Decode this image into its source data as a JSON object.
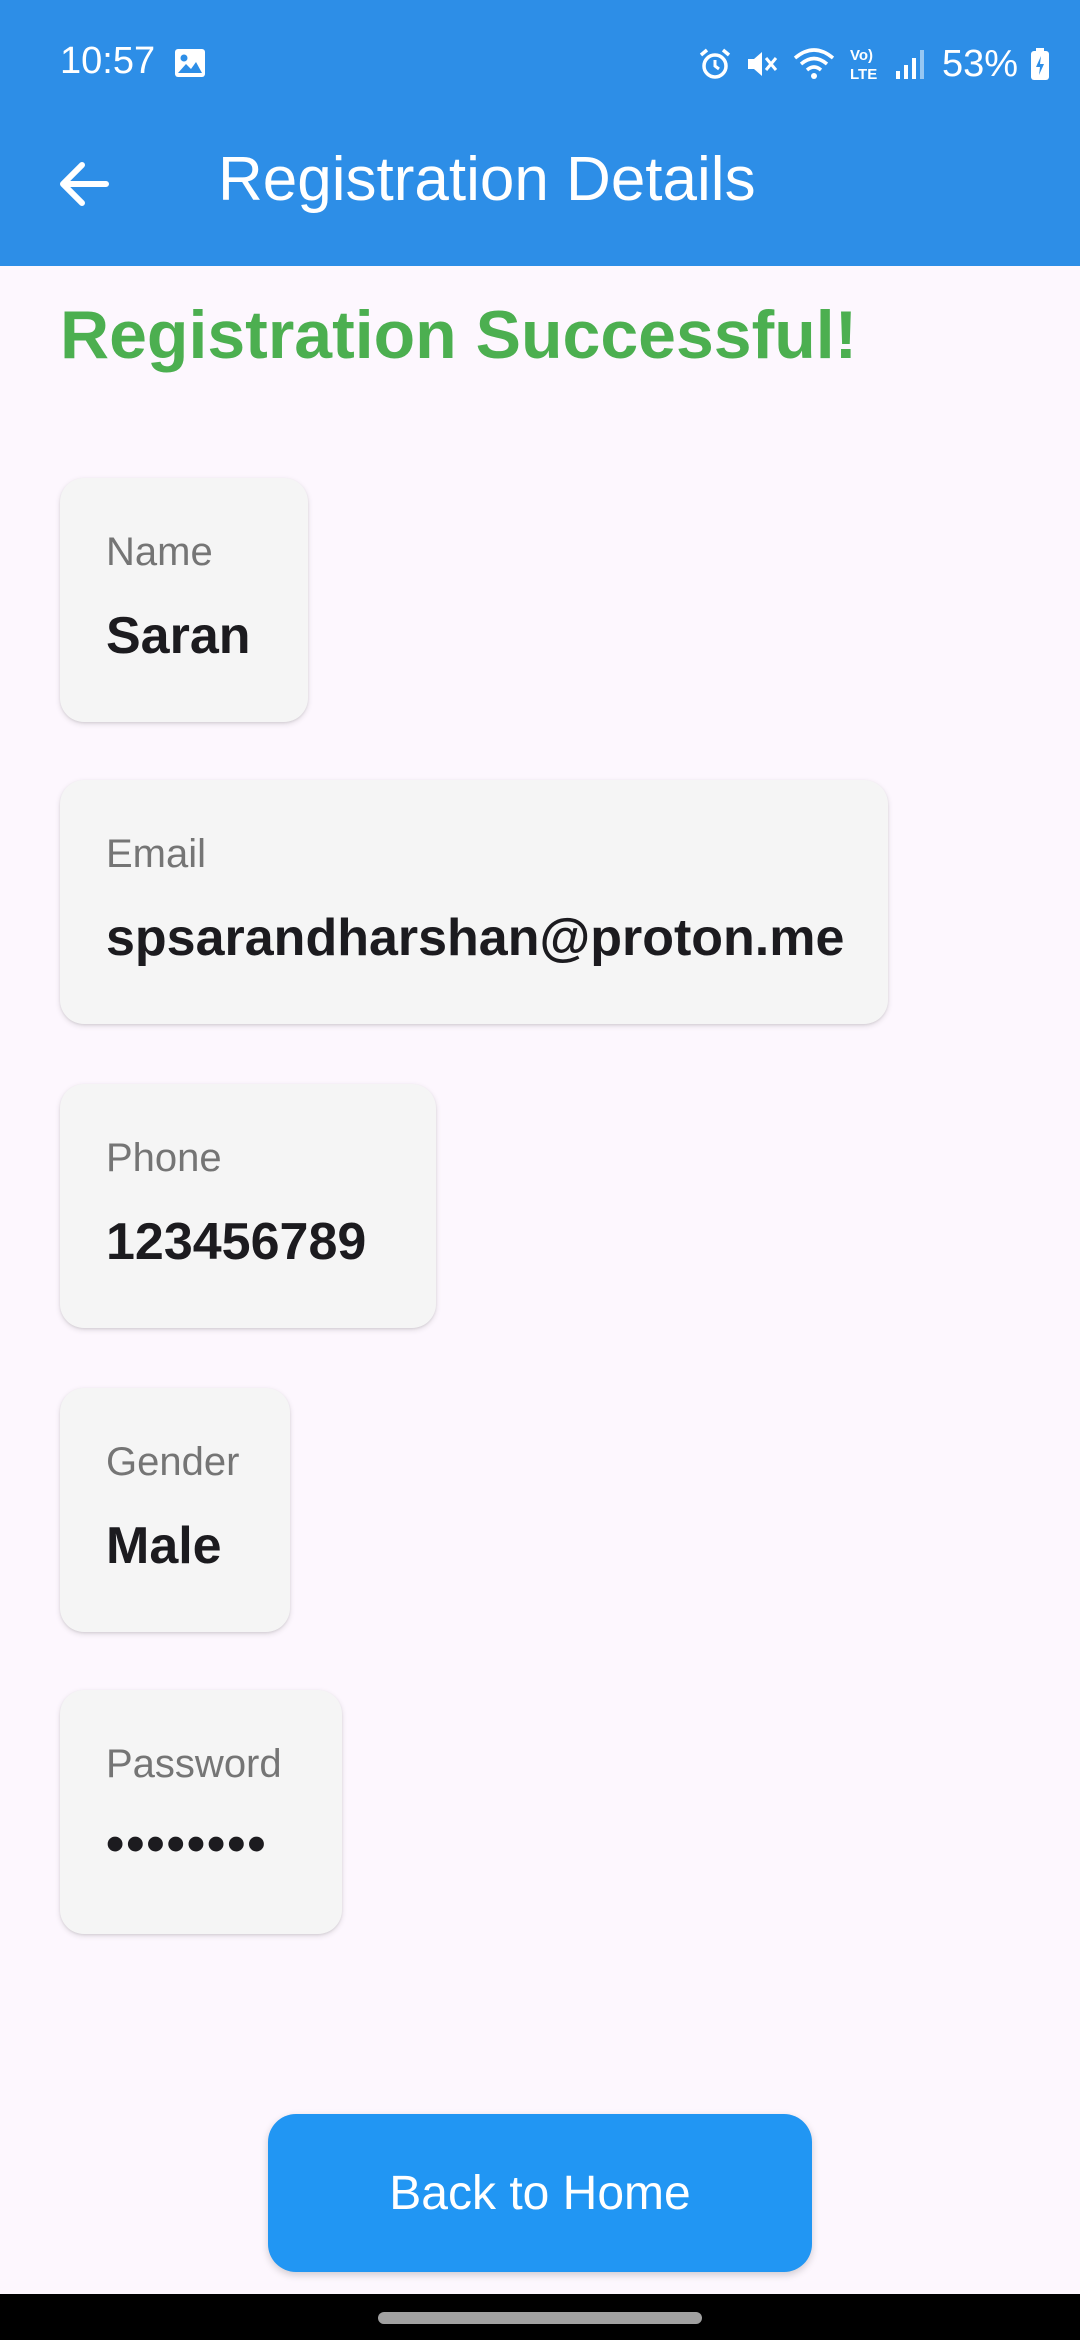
{
  "status_bar": {
    "time": "10:57",
    "battery_percent": "53%",
    "icons": [
      "gallery-icon",
      "alarm-icon",
      "mute-icon",
      "wifi-icon",
      "volte-icon",
      "signal-icon",
      "battery-icon"
    ]
  },
  "appbar": {
    "title": "Registration Details",
    "back_icon": "arrow-left-icon",
    "color": "#2d8ee7"
  },
  "heading": {
    "text": "Registration Successful!",
    "color": "#4caf50"
  },
  "fields": [
    {
      "label": "Name",
      "value": "Saran"
    },
    {
      "label": "Email",
      "value": "spsarandharshan@proton.me"
    },
    {
      "label": "Phone",
      "value": "123456789"
    },
    {
      "label": "Gender",
      "value": "Male"
    },
    {
      "label": "Password",
      "value": "••••••••"
    }
  ],
  "actions": {
    "back_home_label": "Back to Home",
    "button_color": "#2196f3"
  }
}
